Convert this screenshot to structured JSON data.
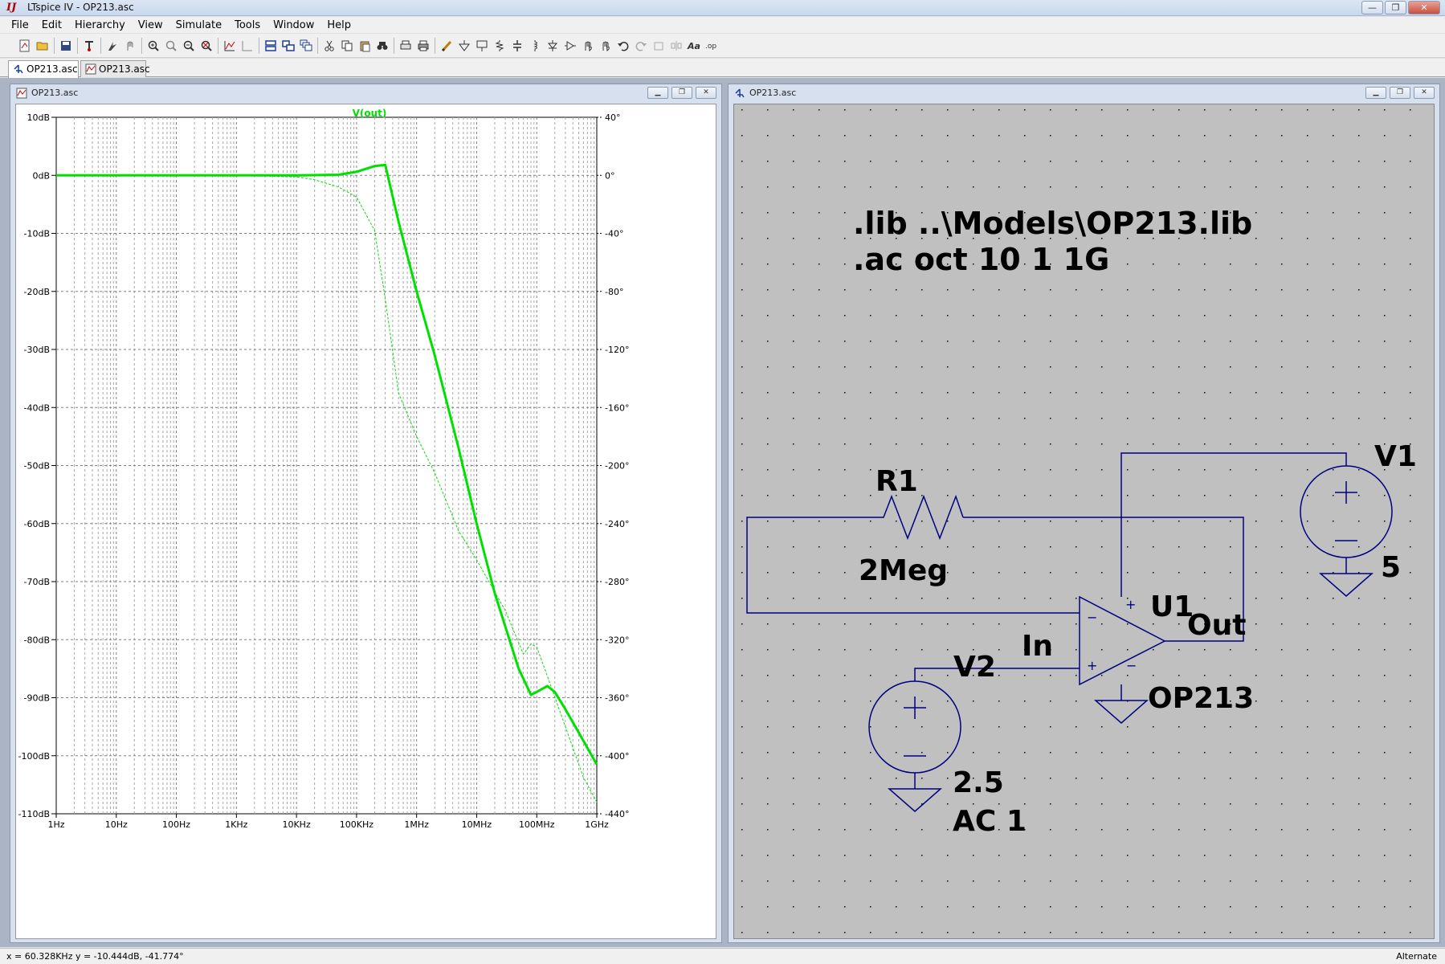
{
  "window": {
    "title": "LTspice IV - OP213.asc",
    "minimize": "—",
    "restore": "❐",
    "close": "✕"
  },
  "menu": [
    "File",
    "Edit",
    "Hierarchy",
    "View",
    "Simulate",
    "Tools",
    "Window",
    "Help"
  ],
  "toolbar": {
    "icons": [
      "new-schematic-icon",
      "open-icon",
      "save-icon",
      "control-panel-icon",
      "run-icon",
      "halt-icon",
      "zoom-in-icon",
      "zoom-pan-icon",
      "zoom-out-icon",
      "zoom-fit-icon",
      "autorange-icon",
      "clear-plot-icon",
      "tile-horizontal-icon",
      "tile-vertical-icon",
      "cascade-icon",
      "cut-icon",
      "copy-icon",
      "paste-icon",
      "find-icon",
      "print-setup-icon",
      "print-icon",
      "draw-wire-icon",
      "ground-icon",
      "label-net-icon",
      "resistor-icon",
      "capacitor-icon",
      "inductor-icon",
      "diode-icon",
      "component-icon",
      "move-icon",
      "drag-icon",
      "undo-icon",
      "redo-icon",
      "rotate-icon",
      "mirror-icon",
      "text-icon",
      "spice-directive-icon"
    ]
  },
  "tabs": [
    {
      "label": "OP213.asc",
      "icon": "schematic-tab-icon",
      "active": true
    },
    {
      "label": "OP213.asc",
      "icon": "plot-tab-icon",
      "active": false
    }
  ],
  "plot_window": {
    "title": "OP213.asc",
    "trace_label": "V(out)",
    "trace_color": "#00e000",
    "background": "#ffffff"
  },
  "schematic_window": {
    "title": "OP213.asc",
    "directives": [
      ".lib ..\\Models\\OP213.lib",
      ".ac oct 10 1 1G"
    ],
    "wire_color": "#000080",
    "components": {
      "r1_ref": "R1",
      "r1_value": "2Meg",
      "v1_ref": "V1",
      "v1_value": "5",
      "v2_ref": "V2",
      "v2_value": "2.5",
      "v2_ac": "AC 1",
      "u1_ref": "U1",
      "u1_value": "OP213"
    },
    "net_labels": {
      "in": "In",
      "out": "Out"
    },
    "pin_marks": {
      "plus": "+",
      "minus": "−"
    }
  },
  "chart_data": {
    "type": "line",
    "title": "",
    "xlabel": "",
    "ylabel": "",
    "xscale": "log",
    "xlim": [
      1,
      1000000000
    ],
    "ylim": [
      -110,
      10
    ],
    "y2lim": [
      -440,
      40
    ],
    "grid": true,
    "x_ticks": [
      "1Hz",
      "10Hz",
      "100Hz",
      "1KHz",
      "10KHz",
      "100KHz",
      "1MHz",
      "10MHz",
      "100MHz",
      "1GHz"
    ],
    "y_ticks": [
      "10dB",
      "0dB",
      "-10dB",
      "-20dB",
      "-30dB",
      "-40dB",
      "-50dB",
      "-60dB",
      "-70dB",
      "-80dB",
      "-90dB",
      "-100dB",
      "-110dB"
    ],
    "y2_ticks": [
      "40°",
      "0°",
      "-40°",
      "-80°",
      "-120°",
      "-160°",
      "-200°",
      "-240°",
      "-280°",
      "-320°",
      "-360°",
      "-400°",
      "-440°"
    ],
    "series": [
      {
        "name": "V(out)",
        "axis": "magnitude",
        "x": [
          1,
          10,
          100,
          1000,
          10000,
          50000,
          100000,
          200000,
          300000,
          500000,
          1000000,
          2000000,
          5000000,
          10000000,
          20000000,
          50000000,
          80000000,
          100000000,
          150000000,
          200000000,
          300000000,
          500000000,
          1000000000
        ],
        "y": [
          0,
          0,
          0,
          0,
          0,
          0.1,
          0.6,
          1.6,
          1.8,
          -8,
          -20,
          -31,
          -47,
          -60,
          -72,
          -85,
          -89.5,
          -89,
          -88,
          -89,
          -92,
          -96,
          -101.5
        ]
      },
      {
        "name": "phase",
        "axis": "phase",
        "x": [
          1,
          1000,
          10000,
          20000,
          50000,
          100000,
          200000,
          300000,
          500000,
          1000000,
          2000000,
          5000000,
          10000000,
          30000000,
          60000000,
          80000000,
          100000000,
          150000000,
          300000000,
          600000000,
          1000000000
        ],
        "y": [
          0,
          0,
          -1,
          -3,
          -8,
          -15,
          -38,
          -85,
          -150,
          -180,
          -205,
          -245,
          -265,
          -300,
          -330,
          -323,
          -325,
          -345,
          -380,
          -415,
          -432
        ]
      }
    ]
  },
  "status": {
    "cursor": "x = 60.328KHz   y = -10.444dB, -41.774°",
    "mode": "Alternate"
  }
}
